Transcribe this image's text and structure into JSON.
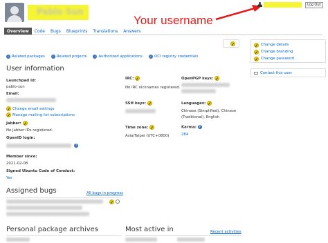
{
  "header": {
    "display_name": "Pablo Sun",
    "annotation": "Your username",
    "logout_label": "Log Out"
  },
  "tabs": [
    {
      "label": "Overview",
      "active": true
    },
    {
      "label": "Code"
    },
    {
      "label": "Bugs"
    },
    {
      "label": "Blueprints"
    },
    {
      "label": "Translations"
    },
    {
      "label": "Answers"
    }
  ],
  "links_row": [
    "Related packages",
    "Related projects",
    "Authorized applications",
    "OCI registry credentials"
  ],
  "sidebar": {
    "items": [
      "Change details",
      "Change branding",
      "Change password"
    ],
    "contact": "Contact this user"
  },
  "user_info": {
    "title": "User information",
    "launchpad_id_label": "Launchpad Id:",
    "launchpad_id": "pablo-sun",
    "email_label": "Email:",
    "change_email": "Change email settings",
    "manage_lists": "Manage mailing list subscriptions",
    "jabber_label": "Jabber:",
    "jabber_value": "No Jabber IDs registered.",
    "openid_label": "OpenID login:",
    "member_since_label": "Member since:",
    "member_since": "2021-02-08",
    "coc_label": "Signed Ubuntu Code of Conduct:",
    "coc_value": "Yes",
    "irc_label": "IRC:",
    "irc_value": "No IRC nicknames registered.",
    "ssh_label": "SSH keys:",
    "timezone_label": "Time zone:",
    "timezone_value": "Asia/Taipei (UTC+0800)",
    "openpgp_label": "OpenPGP keys:",
    "languages_label": "Languages:",
    "languages_value_1": "Chinese (Simplified), Chinese",
    "languages_value_2": "(Traditional), English",
    "karma_label": "Karma:",
    "karma_value": "284"
  },
  "assigned_bugs": {
    "title": "Assigned bugs",
    "all_link": "All bugs in progress"
  },
  "ppa": {
    "title": "Personal package archives"
  },
  "most_active": {
    "title": "Most active in",
    "recent_link": "Recent activities"
  }
}
